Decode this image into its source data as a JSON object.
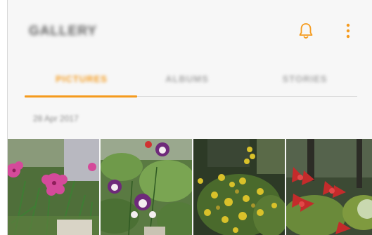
{
  "app": {
    "title": "GALLERY"
  },
  "header": {
    "notification_icon": "bell-icon",
    "more_icon": "more-vertical-icon"
  },
  "tabs": [
    {
      "label": "PICTURES",
      "active": true
    },
    {
      "label": "ALBUMS",
      "active": false
    },
    {
      "label": "STORIES",
      "active": false
    }
  ],
  "section": {
    "date": "28 Apr 2017"
  },
  "photos": [
    {
      "subject": "pink-dianthus-flowers"
    },
    {
      "subject": "purple-white-columbine"
    },
    {
      "subject": "yellow-flowering-shrub"
    },
    {
      "subject": "red-tropical-flowers"
    }
  ],
  "colors": {
    "accent": "#f59b1e",
    "background": "#f7f7f7"
  }
}
